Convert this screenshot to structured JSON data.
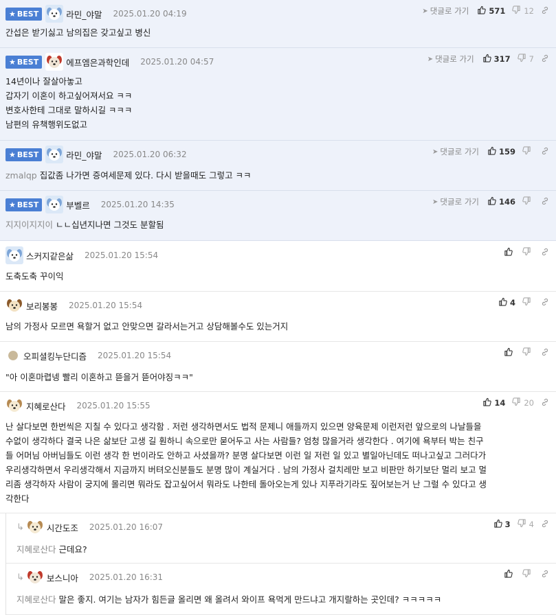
{
  "best_label": "BEST",
  "goto_label": "댓글로 가기",
  "comments": [
    {
      "best": true,
      "nick": "라민_야말",
      "date": "2025.01.20 04:19",
      "goto": true,
      "up": "571",
      "down": "12",
      "mention": "",
      "lines": [
        "간섭은 받기싫고 남의집은 갖고싶고 병신"
      ],
      "avatar": "dog-blue"
    },
    {
      "best": true,
      "nick": "에프엠은과학인데",
      "date": "2025.01.20 04:57",
      "goto": true,
      "up": "317",
      "down": "7",
      "mention": "",
      "lines": [
        "14년이나 잘살아놓고",
        "갑자기 이혼이 하고싶어져서요 ㅋㅋ",
        "변호사한테 그대로 말하시길 ㅋㅋㅋ",
        "남편의 유책행위도없고"
      ],
      "avatar": "dog-red"
    },
    {
      "best": true,
      "nick": "라민_야말",
      "date": "2025.01.20 06:32",
      "goto": true,
      "up": "159",
      "down": "",
      "mention": "zmalqp",
      "lines": [
        "집값좀 나가면 증여세문제 있다. 다시 받을때도 그렇고 ㅋㅋ"
      ],
      "avatar": "dog-blue"
    },
    {
      "best": true,
      "nick": "부벨르",
      "date": "2025.01.20 14:35",
      "goto": true,
      "up": "146",
      "down": "",
      "mention": "지지이지지이",
      "lines": [
        "ㄴㄴ십년지나면 그것도 분할됨"
      ],
      "avatar": "dog-blue"
    },
    {
      "best": false,
      "nick": "스커지같은삶",
      "date": "2025.01.20 15:54",
      "goto": false,
      "up": "",
      "down": "",
      "mention": "",
      "lines": [
        "도축도축 꾸이익"
      ],
      "avatar": "dog-blue"
    },
    {
      "best": false,
      "nick": "보리봉봉",
      "date": "2025.01.20 15:54",
      "goto": false,
      "up": "4",
      "down": "",
      "mention": "",
      "lines": [
        "남의 가정사 모르면 욕할거 없고 안맞으면 갈라서는거고 상담해볼수도 있는거지"
      ],
      "avatar": "dog-brown"
    },
    {
      "best": false,
      "nick": "오피셜킹누단디즘",
      "date": "2025.01.20 15:54",
      "goto": false,
      "up": "",
      "down": "",
      "mention": "",
      "lines": [
        "\"아 이혼마렵넹 빨리 이혼하고 뜯을거 뜯어야징ㅋㅋ\""
      ],
      "avatar": "dot"
    },
    {
      "best": false,
      "nick": "지혜로산다",
      "date": "2025.01.20 15:55",
      "goto": false,
      "up": "14",
      "down": "20",
      "mention": "",
      "lines": [
        "난 살다보면 한번씩은 지칠 수 있다고 생각함 . 저런 생각하면서도 법적 문제니 애들까지 있으면 양육문제 이런저런 앞으로의 나날들을",
        "수없이 생각하다 결국 나은 삶보단 고생 길 훤하니 속으로만 묻어두고 사는 사람들? 엄청 많을거라 생각한다 . 여기에 욕부터 박는 친구",
        "들 어머님 아버님들도 이런 생각 한 번이라도 안하고 사셨을까? 분명 살다보면 이런 일 저런 일 있고 별일아닌데도 떠나고싶고 그러다가",
        "우리생각하면서 우리생각해서 지금까지 버텨오신분들도 분명 많이 계실거다 . 남의 가정사 걸치레만 보고 비판만 하기보단 멀리 보고 멀",
        "리좀 생각하자 사람이 궁지에 몰리면 뭐라도 잡고싶어서 뭐라도 나한테 돌아오는게 있나 지푸라기라도 짚어보는거 난 그럴 수 있다고 생",
        "각한다"
      ],
      "avatar": "dog-cream"
    },
    {
      "best": false,
      "reply": true,
      "nick": "시간도조",
      "date": "2025.01.20 16:07",
      "goto": false,
      "up": "3",
      "down": "4",
      "mention": "지혜로산다",
      "lines": [
        "근데요?"
      ],
      "avatar": "dog-cream"
    },
    {
      "best": false,
      "reply": true,
      "nick": "보스니아",
      "date": "2025.01.20 16:31",
      "goto": false,
      "up": "",
      "down": "",
      "mention": "지혜로산다",
      "lines": [
        "말은 좋지. 여기는 남자가 힘든글 올리면 왜 올려서 와이프 욕먹게 만드냐고 개지랄하는 곳인데? ㅋㅋㅋㅋㅋ"
      ],
      "avatar": "dog-red"
    }
  ]
}
